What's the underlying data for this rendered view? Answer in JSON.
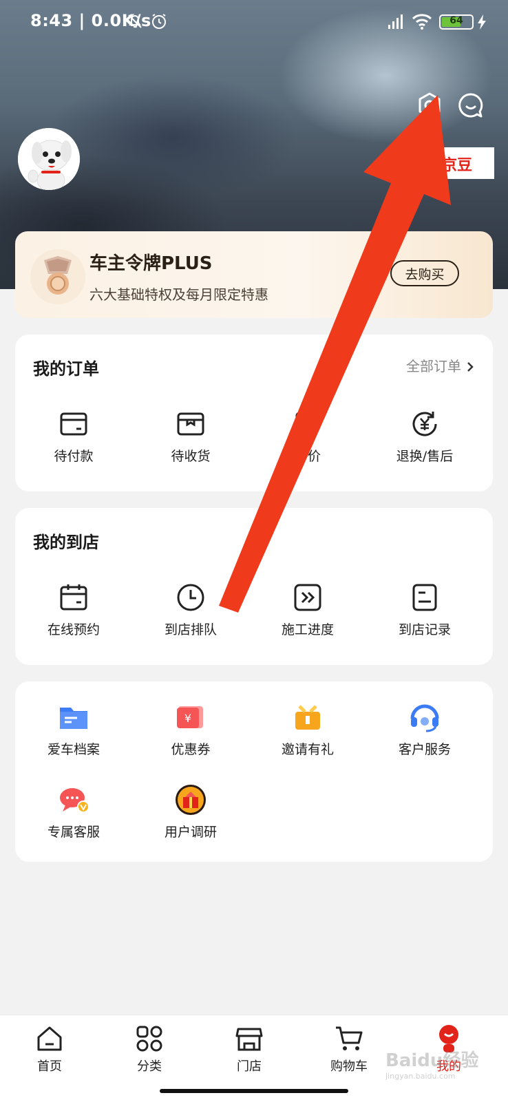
{
  "status_bar": {
    "time": "8:43 | 0.0K/s",
    "battery": "64",
    "battery_fraction": 0.64
  },
  "header": {
    "settings_icon": "settings-icon",
    "message_icon": "message-icon",
    "beans_label": "京豆"
  },
  "plus_banner": {
    "title": "车主令牌PLUS",
    "subtitle": "六大基础特权及每月限定特惠",
    "button": "去购买"
  },
  "orders": {
    "title": "我的订单",
    "all_label": "全部订单",
    "items": [
      {
        "label": "待付款",
        "icon": "wallet-icon"
      },
      {
        "label": "待收货",
        "icon": "box-icon"
      },
      {
        "label": "评价",
        "icon": "comment-icon"
      },
      {
        "label": "退换/售后",
        "icon": "refund-icon"
      }
    ]
  },
  "store_visits": {
    "title": "我的到店",
    "items": [
      {
        "label": "在线预约",
        "icon": "calendar-icon"
      },
      {
        "label": "到店排队",
        "icon": "clock-icon"
      },
      {
        "label": "施工进度",
        "icon": "progress-icon"
      },
      {
        "label": "到店记录",
        "icon": "record-icon"
      }
    ]
  },
  "services": {
    "items": [
      {
        "label": "爱车档案",
        "icon": "folder-icon"
      },
      {
        "label": "优惠券",
        "icon": "coupon-icon"
      },
      {
        "label": "邀请有礼",
        "icon": "gift-icon"
      },
      {
        "label": "客户服务",
        "icon": "headset-icon"
      },
      {
        "label": "专属客服",
        "icon": "chat-bubble-icon"
      },
      {
        "label": "用户调研",
        "icon": "survey-gift-icon"
      }
    ]
  },
  "bottom_nav": {
    "tabs": [
      {
        "label": "首页",
        "icon": "home-icon"
      },
      {
        "label": "分类",
        "icon": "grid-icon"
      },
      {
        "label": "门店",
        "icon": "store-icon"
      },
      {
        "label": "购物车",
        "icon": "cart-icon"
      },
      {
        "label": "我的",
        "icon": "profile-icon"
      }
    ]
  },
  "colors": {
    "accent": "#e2231a",
    "arrow": "#f03a1c"
  },
  "watermark": {
    "text": "Baidu经验",
    "sub": "jingyan.baidu.com"
  }
}
